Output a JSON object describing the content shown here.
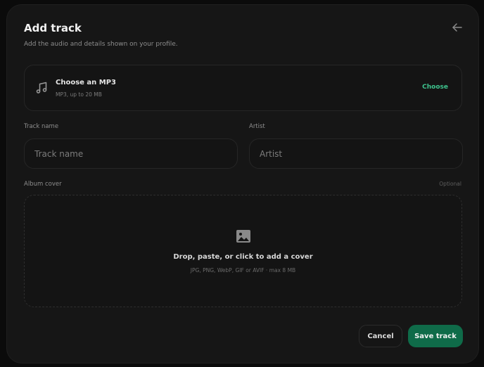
{
  "modal": {
    "title": "Add track",
    "subtitle": "Add the audio and details shown on your profile.",
    "back_icon": "arrow-left-icon"
  },
  "file_picker": {
    "icon": "music-note-icon",
    "title": "Choose an MP3",
    "hint": "MP3, up to 20 MB",
    "choose_label": "Choose"
  },
  "fields": {
    "track_name": {
      "label": "Track name",
      "placeholder": "Track name",
      "value": ""
    },
    "artist": {
      "label": "Artist",
      "placeholder": "Artist",
      "value": ""
    }
  },
  "album_cover": {
    "label": "Album cover",
    "optional_label": "Optional",
    "icon": "image-icon",
    "drop_title": "Drop, paste, or click to add a cover",
    "drop_hint": "JPG, PNG, WebP, GIF or AVIF · max 8 MB"
  },
  "actions": {
    "cancel_label": "Cancel",
    "save_label": "Save track"
  },
  "colors": {
    "accent": "#3ec48e",
    "primary_button": "#0f6b49",
    "surface": "#161616"
  }
}
